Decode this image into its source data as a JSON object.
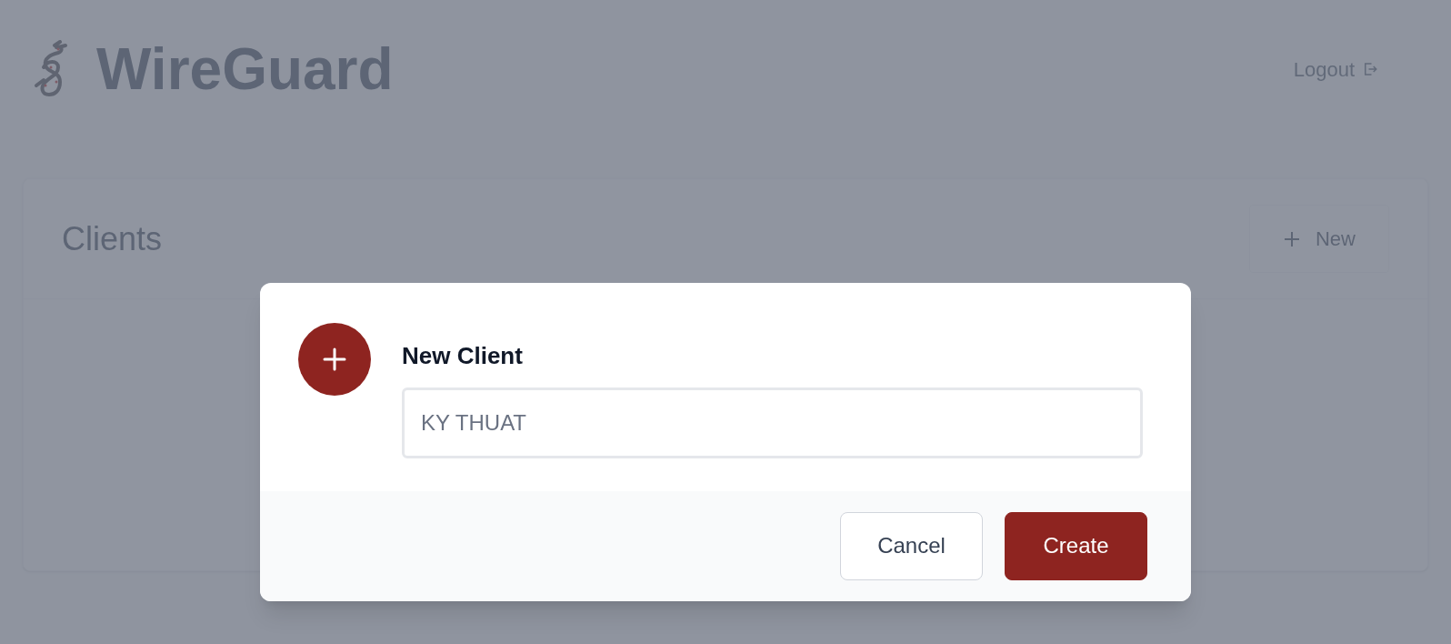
{
  "header": {
    "title": "WireGuard",
    "logout": "Logout"
  },
  "clients_card": {
    "title": "Clients",
    "new_button": "New"
  },
  "dialog": {
    "title": "New Client",
    "name_field": {
      "value": "KY THUAT"
    },
    "buttons": [
      {
        "label": "Cancel",
        "kind": "secondary"
      },
      {
        "label": "Create",
        "kind": "primary"
      }
    ]
  }
}
